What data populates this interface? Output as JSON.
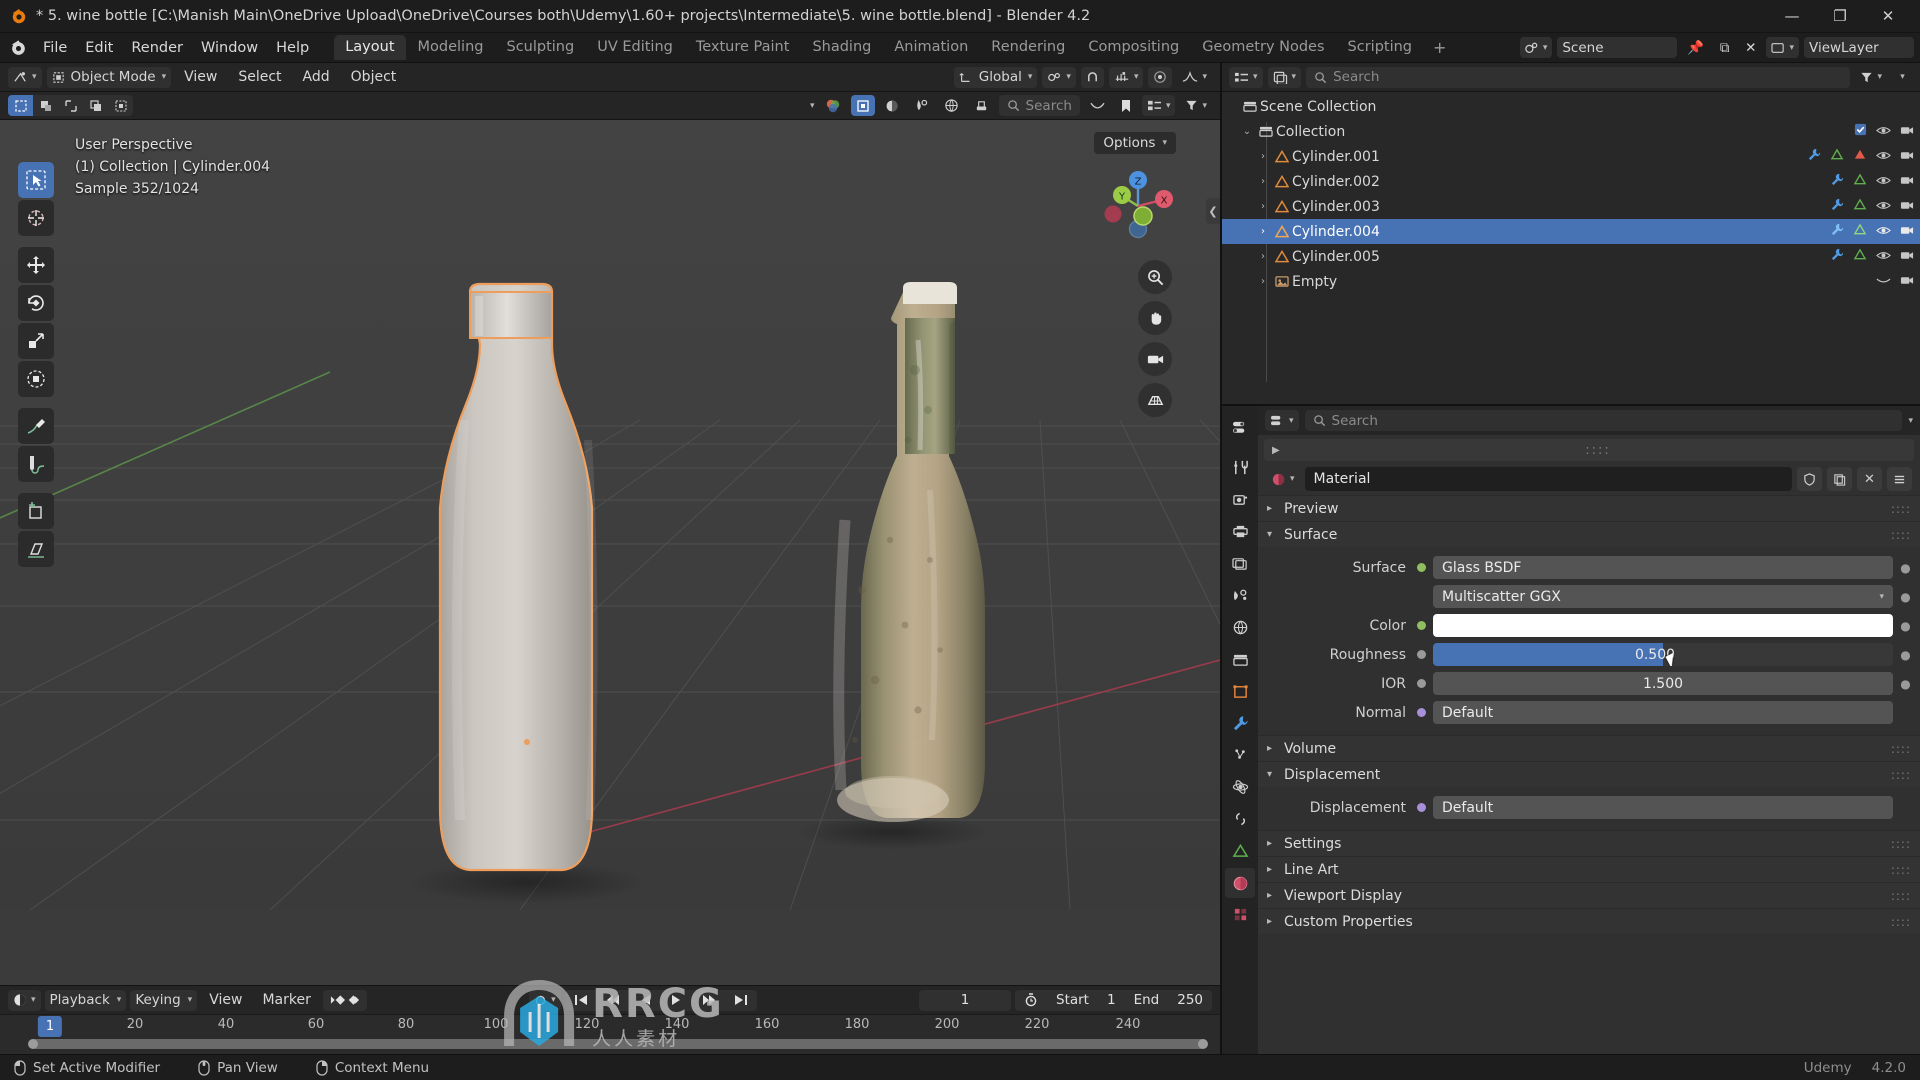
{
  "window": {
    "title": "* 5. wine bottle [C:\\Manish Main\\OneDrive Upload\\OneDrive\\Courses both\\Udemy\\1.60+ projects\\Intermediate\\5. wine bottle.blend] - Blender 4.2",
    "minimize": "—",
    "maximize": "❐",
    "close": "✕"
  },
  "topbar": {
    "menus": [
      "File",
      "Edit",
      "Render",
      "Window",
      "Help"
    ],
    "workspaces": [
      "Layout",
      "Modeling",
      "Sculpting",
      "UV Editing",
      "Texture Paint",
      "Shading",
      "Animation",
      "Rendering",
      "Compositing",
      "Geometry Nodes",
      "Scripting"
    ],
    "active_workspace": "Layout",
    "add_workspace": "+"
  },
  "viewport_header": {
    "mode": "Object Mode",
    "menus": [
      "View",
      "Select",
      "Add",
      "Object"
    ],
    "transform_orientation": "Global",
    "options_label": "Options",
    "search_placeholder": "Search"
  },
  "viewport": {
    "perspective": "User Perspective",
    "collection_line": "(1) Collection | Cylinder.004",
    "sample_line": "Sample 352/1024",
    "gizmo_axes": [
      "X",
      "Y",
      "Z"
    ],
    "tools": [
      "tweak-tool",
      "cursor-tool",
      "move-tool",
      "rotate-tool",
      "scale-tool",
      "transform-tool",
      "annotate-tool",
      "measure-tool",
      "add-cube-tool",
      "shear-tool"
    ]
  },
  "scene_header": {
    "scene_name": "Scene",
    "view_layer_name": "ViewLayer"
  },
  "outliner": {
    "search_placeholder": "Search",
    "rows": [
      {
        "name": "Scene Collection",
        "indent": 0,
        "icon": "collection-icon",
        "arrow": "",
        "selected": false,
        "visible_icons": false
      },
      {
        "name": "Collection",
        "indent": 1,
        "icon": "collection-icon",
        "arrow": "⌄",
        "selected": false,
        "visible_icons": true,
        "checkbox": true
      },
      {
        "name": "Cylinder.001",
        "indent": 2,
        "icon": "mesh-icon",
        "arrow": "›",
        "selected": false,
        "visible_icons": true,
        "mods": [
          "wrench",
          "modifier",
          "material"
        ]
      },
      {
        "name": "Cylinder.002",
        "indent": 2,
        "icon": "mesh-icon",
        "arrow": "›",
        "selected": false,
        "visible_icons": true,
        "mods": [
          "wrench",
          "modifier"
        ]
      },
      {
        "name": "Cylinder.003",
        "indent": 2,
        "icon": "mesh-icon",
        "arrow": "›",
        "selected": false,
        "visible_icons": true,
        "mods": [
          "wrench",
          "modifier"
        ]
      },
      {
        "name": "Cylinder.004",
        "indent": 2,
        "icon": "mesh-icon",
        "arrow": "›",
        "selected": true,
        "visible_icons": true,
        "mods": [
          "wrench",
          "modifier"
        ]
      },
      {
        "name": "Cylinder.005",
        "indent": 2,
        "icon": "mesh-icon",
        "arrow": "›",
        "selected": false,
        "visible_icons": true,
        "mods": [
          "wrench",
          "modifier"
        ]
      },
      {
        "name": "Empty",
        "indent": 2,
        "icon": "image-icon",
        "arrow": "›",
        "selected": false,
        "visible_icons": true,
        "mods": []
      }
    ]
  },
  "properties": {
    "search_placeholder": "Search",
    "material_name": "Material",
    "tabs": [
      "tool-tab",
      "render-tab",
      "output-tab",
      "view-layer-tab",
      "scene-tab",
      "world-tab",
      "collection-tab",
      "object-tab",
      "modifier-tab",
      "particles-tab",
      "physics-tab",
      "constraints-tab",
      "data-tab",
      "material-tab",
      "texture-tab"
    ],
    "active_tab": "material-tab",
    "panels": [
      {
        "label": "Preview",
        "open": false
      },
      {
        "label": "Surface",
        "open": true
      },
      {
        "label": "Volume",
        "open": false
      },
      {
        "label": "Displacement",
        "open": true
      },
      {
        "label": "Settings",
        "open": false
      },
      {
        "label": "Line Art",
        "open": false
      },
      {
        "label": "Viewport Display",
        "open": false
      },
      {
        "label": "Custom Properties",
        "open": false
      }
    ],
    "surface": {
      "surface_label": "Surface",
      "surface_value": "Glass BSDF",
      "distribution_value": "Multiscatter GGX",
      "color_label": "Color",
      "color_value": "#ffffff",
      "roughness_label": "Roughness",
      "roughness_value": "0.500",
      "roughness_fraction": 0.5,
      "ior_label": "IOR",
      "ior_value": "1.500",
      "normal_label": "Normal",
      "normal_value": "Default"
    },
    "displacement": {
      "label": "Displacement",
      "value": "Default"
    }
  },
  "timeline": {
    "editor_menus": [
      "Playback",
      "Keying",
      "View",
      "Marker"
    ],
    "current_frame": "1",
    "start_label": "Start",
    "start_value": "1",
    "end_label": "End",
    "end_value": "250",
    "playhead_frame": "1",
    "ticks": [
      "20",
      "40",
      "60",
      "80",
      "100",
      "120",
      "140",
      "160",
      "180",
      "200",
      "220",
      "240"
    ]
  },
  "statusbar": {
    "items": [
      "Set Active Modifier",
      "Pan View",
      "Context Menu"
    ],
    "version": "4.2.0"
  },
  "watermark": {
    "main": "RRCG",
    "sub": "人人素材",
    "brand": "Udemy"
  },
  "colors": {
    "accent_blue": "#4772b3",
    "selection_orange": "#ed9e5c",
    "panel_bg": "#303030",
    "editor_bg": "#282828"
  }
}
